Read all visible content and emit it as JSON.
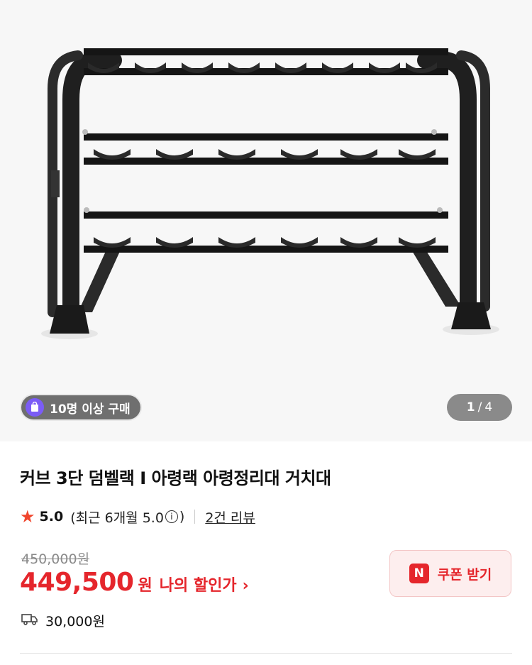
{
  "gallery": {
    "image_alt": "커브 3단 덤벨랙 I 아령랙 아령정리대 거치대",
    "group_badge": "10명 이상 구매",
    "badge_icon": "purple-tag-icon",
    "pager_current": "1",
    "pager_total": "4"
  },
  "product": {
    "title": "커브 3단 덤벨랙 I 아령랙 아령정리대 거치대",
    "rating": "5.0",
    "recent_prefix": "(최근 6개월 5.0",
    "recent_suffix": ")",
    "review_link": "2건 리뷰",
    "original_price": "450,000원",
    "sale_price": "449,500",
    "currency": "원",
    "my_discount": "나의 할인가",
    "coupon_logo": "N",
    "coupon_label": "쿠폰 받기",
    "shipping_fee": "30,000원"
  },
  "colors": {
    "accent": "#e5262c",
    "badge_bg": "#6f6f6f",
    "badge_icon": "#7b5cf6",
    "coupon_bg": "#fdeeee"
  }
}
